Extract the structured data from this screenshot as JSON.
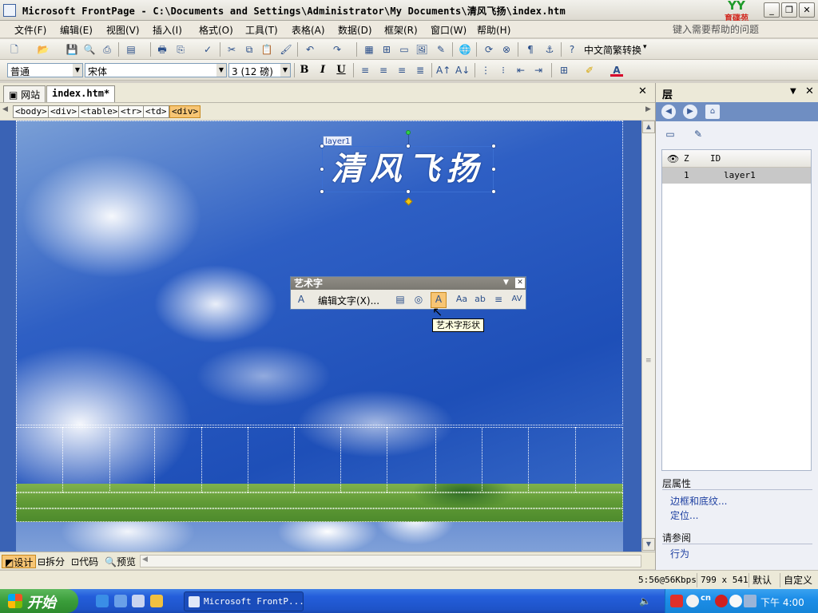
{
  "window": {
    "title": "Microsoft FrontPage - C:\\Documents and Settings\\Administrator\\My Documents\\清风飞扬\\index.htm",
    "logo_text": "育碟苑"
  },
  "menu": [
    "文件(F)",
    "编辑(E)",
    "视图(V)",
    "插入(I)",
    "格式(O)",
    "工具(T)",
    "表格(A)",
    "数据(D)",
    "框架(R)",
    "窗口(W)",
    "帮助(H)"
  ],
  "help_placeholder": "键入需要帮助的问题",
  "toolbar": {
    "convert_label": "中文简繁转换"
  },
  "format": {
    "style": "普通",
    "font": "宋体",
    "size": "3 (12 磅)"
  },
  "tabs": {
    "site": "网站",
    "doc": "index.htm*"
  },
  "tags": [
    "<body>",
    "<div>",
    "<table>",
    "<tr>",
    "<td>",
    "<div>"
  ],
  "layer": {
    "label": "layer1",
    "wordart_text": "清风飞扬"
  },
  "wordart_toolbar": {
    "title": "艺术字",
    "edit_label": "编辑文字(X)...",
    "tooltip": "艺术字形状"
  },
  "views": [
    "设计",
    "拆分",
    "代码",
    "预览"
  ],
  "pane": {
    "title": "层",
    "col_z": "Z",
    "col_id": "ID",
    "rows": [
      {
        "z": "1",
        "id": "layer1"
      }
    ],
    "props_title": "层属性",
    "links": [
      "边框和底纹...",
      "定位..."
    ],
    "see_also": "请参阅",
    "see_links": [
      "行为"
    ]
  },
  "status": {
    "speed": "5:56@56Kbps",
    "size": "799 x 541",
    "mode": "默认",
    "custom": "自定义"
  },
  "taskbar": {
    "start": "开始",
    "app": "Microsoft FrontP...",
    "clock": "下午 4:00"
  }
}
